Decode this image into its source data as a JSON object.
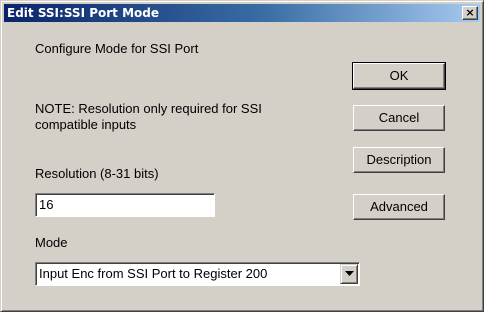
{
  "window": {
    "title": "Edit SSI:SSI Port Mode",
    "close_label": "×"
  },
  "form": {
    "configure_label": "Configure Mode for SSI Port",
    "note_line1": "NOTE:  Resolution only required for SSI",
    "note_line2": "compatible inputs",
    "resolution_label": "Resolution (8-31 bits)",
    "resolution_value": "16",
    "mode_label": "Mode",
    "mode_value": "Input Enc from SSI Port to Register 200"
  },
  "buttons": {
    "ok": "OK",
    "cancel": "Cancel",
    "description": "Description",
    "advanced": "Advanced"
  },
  "icons": {
    "close": "close-icon",
    "dropdown": "chevron-down-icon"
  }
}
